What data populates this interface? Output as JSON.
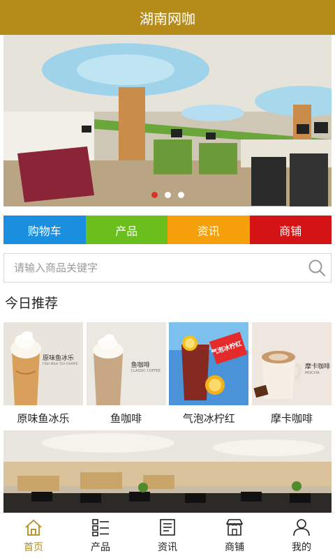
{
  "header": {
    "title": "湖南网咖"
  },
  "banner": {
    "slide_count": 3,
    "active_slide": 0
  },
  "categories": [
    {
      "label": "购物车",
      "color": "#1a8fe0"
    },
    {
      "label": "产品",
      "color": "#6bbf1c"
    },
    {
      "label": "资讯",
      "color": "#f5a00a"
    },
    {
      "label": "商铺",
      "color": "#d41414"
    }
  ],
  "search": {
    "placeholder": "请输入商品关键字",
    "icon": "search-icon"
  },
  "recommend": {
    "title": "今日推荐",
    "items": [
      {
        "name": "原味鱼冰乐",
        "image_caption": "原味鱼冰乐",
        "image_caption_en": "FISH MILK TEA FRAPPE"
      },
      {
        "name": "鱼咖啡",
        "image_caption": "鱼咖啡",
        "image_caption_en": "CLASSIC COFFEE"
      },
      {
        "name": "气泡冰柠红",
        "image_caption": "气泡冰柠红"
      },
      {
        "name": "摩卡咖啡",
        "image_caption": "摩卡咖啡",
        "image_caption_en": "MOCHA"
      }
    ]
  },
  "tabbar": {
    "items": [
      {
        "label": "首页",
        "icon": "home-icon",
        "active": true
      },
      {
        "label": "产品",
        "icon": "grid-list-icon",
        "active": false
      },
      {
        "label": "资讯",
        "icon": "document-icon",
        "active": false
      },
      {
        "label": "商铺",
        "icon": "shop-icon",
        "active": false
      },
      {
        "label": "我的",
        "icon": "user-icon",
        "active": false
      }
    ],
    "active_color": "#b58c1a"
  }
}
